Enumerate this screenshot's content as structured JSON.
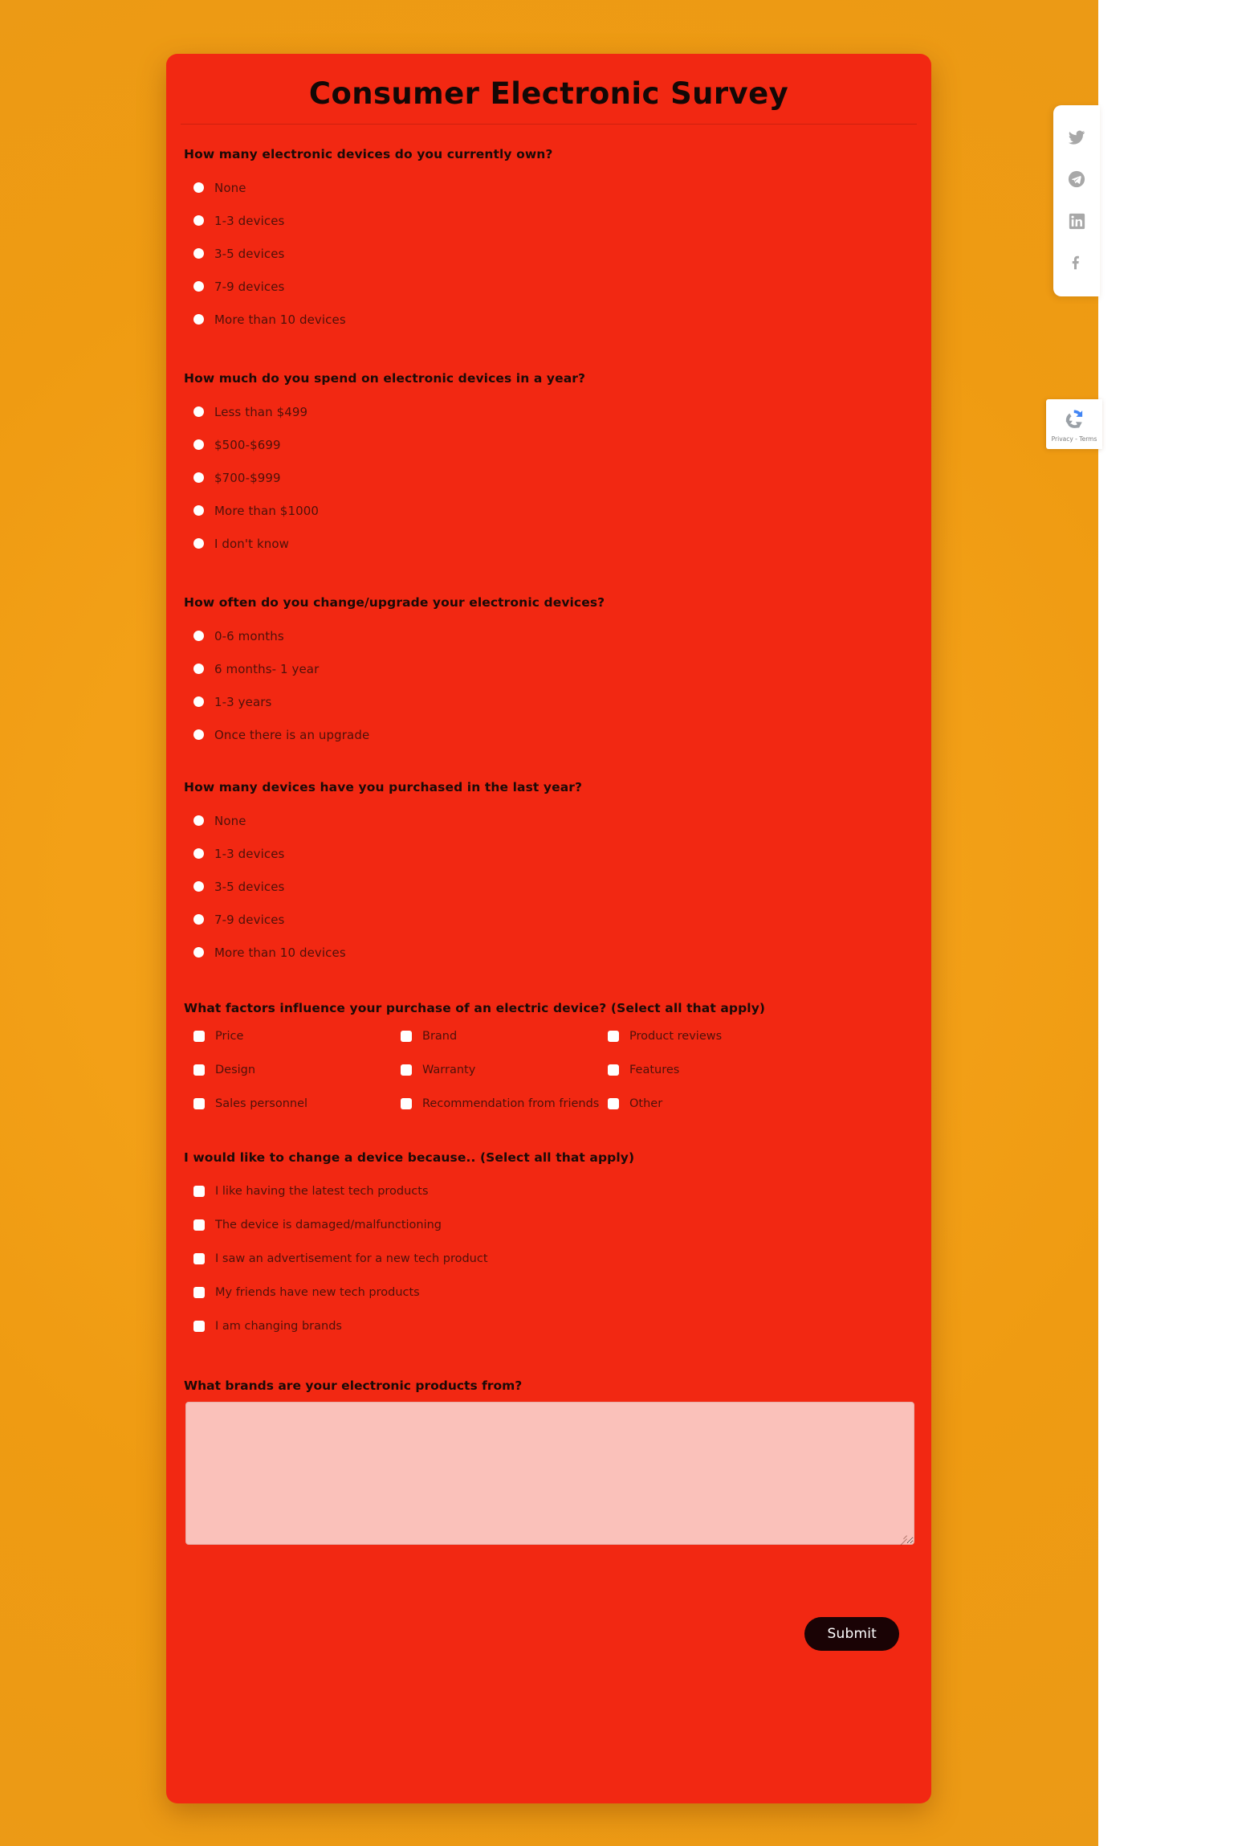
{
  "page": {
    "background_start": "#f2a417",
    "background_end": "#ee9d13",
    "card_color": "#f22812"
  },
  "survey": {
    "title": "Consumer Electronic Survey",
    "questions": [
      {
        "id": "devices-owned",
        "label": "How many electronic devices do you currently own?",
        "type": "radio",
        "options": [
          "None",
          "1-3 devices",
          "3-5 devices",
          "7-9 devices",
          "More than 10 devices"
        ]
      },
      {
        "id": "yearly-spend",
        "label": "How much do you spend on electronic devices in a year?",
        "type": "radio",
        "options": [
          "Less than $499",
          "$500-$699",
          "$700-$999",
          "More than $1000",
          "I don't know"
        ]
      },
      {
        "id": "upgrade-frequency",
        "label": "How often do you change/upgrade your electronic devices?",
        "type": "radio",
        "options": [
          "0-6 months",
          "6 months- 1 year",
          "1-3 years",
          "Once there is an upgrade"
        ]
      },
      {
        "id": "devices-purchased",
        "label": "How many devices have you purchased in the last year?",
        "type": "radio",
        "options": [
          "None",
          "1-3 devices",
          "3-5 devices",
          "7-9 devices",
          "More than 10 devices"
        ]
      },
      {
        "id": "purchase-factors",
        "label": "What factors influence your purchase of an electric device? (Select all that apply)",
        "type": "checkbox-grid",
        "options": [
          "Price",
          "Brand",
          "Product reviews",
          "Design",
          "Warranty",
          "Features",
          "Sales personnel",
          "Recommendation from friends",
          "Other"
        ]
      },
      {
        "id": "change-reasons",
        "label": "I would like to change a device because.. (Select all that apply)",
        "type": "checkbox-list",
        "options": [
          "I like having the latest tech products",
          "The device is damaged/malfunctioning",
          "I saw an advertisement for a new tech product",
          "My friends have new tech products",
          "I am changing brands"
        ]
      },
      {
        "id": "brands",
        "label": "What brands are your electronic products from?",
        "type": "textarea",
        "value": "",
        "placeholder": ""
      }
    ],
    "submit_label": "Submit"
  },
  "social": {
    "items": [
      {
        "name": "twitter-icon",
        "label": "Twitter"
      },
      {
        "name": "telegram-icon",
        "label": "Telegram"
      },
      {
        "name": "linkedin-icon",
        "label": "LinkedIn"
      },
      {
        "name": "facebook-icon",
        "label": "Facebook"
      }
    ],
    "icon_color": "#a8a8a8"
  },
  "recaptcha": {
    "terms_label": "Privacy - Terms"
  }
}
